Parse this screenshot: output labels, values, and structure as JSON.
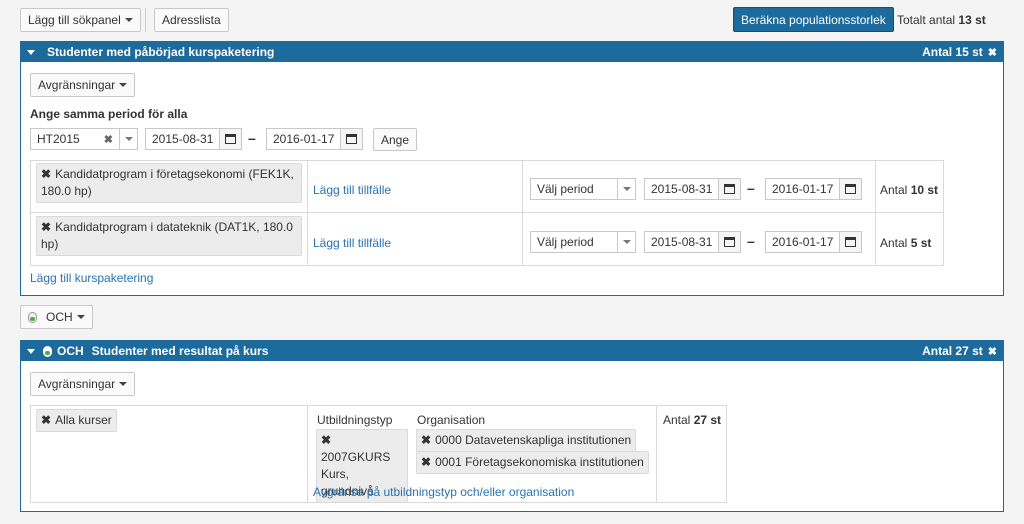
{
  "toolbar": {
    "add_panel": "Lägg till sökpanel",
    "address_list": "Adresslista",
    "calc_button": "Beräkna populationsstorlek",
    "total_prefix": "Totalt antal",
    "total_value": "13 st"
  },
  "panel1": {
    "title": "Studenter med påbörjad kurspaketering",
    "count_prefix": "Antal",
    "count_value": "15 st",
    "restrictions": "Avgränsningar",
    "same_period_label": "Ange samma period för alla",
    "period_value": "HT2015",
    "from_date": "2015-08-31",
    "to_date": "2016-01-17",
    "apply": "Ange",
    "add_package": "Lägg till kurspaketering",
    "rows": [
      {
        "program": "Kandidatprogram i företagsekonomi (FEK1K, 180.0 hp)",
        "add_occasion": "Lägg till tillfälle",
        "period_placeholder": "Välj period",
        "from": "2015-08-31",
        "to": "2016-01-17",
        "count_prefix": "Antal",
        "count_value": "10 st"
      },
      {
        "program": "Kandidatprogram i datateknik (DAT1K, 180.0 hp)",
        "add_occasion": "Lägg till tillfälle",
        "period_placeholder": "Välj period",
        "from": "2015-08-31",
        "to": "2016-01-17",
        "count_prefix": "Antal",
        "count_value": "5 st"
      }
    ]
  },
  "operator_button": "OCH",
  "panel2": {
    "operator": "OCH",
    "title": "Studenter med resultat på kurs",
    "count_prefix": "Antal",
    "count_value": "27 st",
    "restrictions": "Avgränsningar",
    "all_courses": "Alla kurser",
    "edu_type_header": "Utbildningstyp",
    "edu_type_tag": [
      "2007GKURS",
      "Kurs, grundnivå"
    ],
    "org_header": "Organisation",
    "org_tags": [
      "0000 Datavetenskapliga institutionen",
      "0001 Företagsekonomiska institutionen"
    ],
    "restrict_link": "Avgränsa på utbildningstyp och/eller organisation",
    "result_prefix": "Antal",
    "result_value": "27 st"
  }
}
